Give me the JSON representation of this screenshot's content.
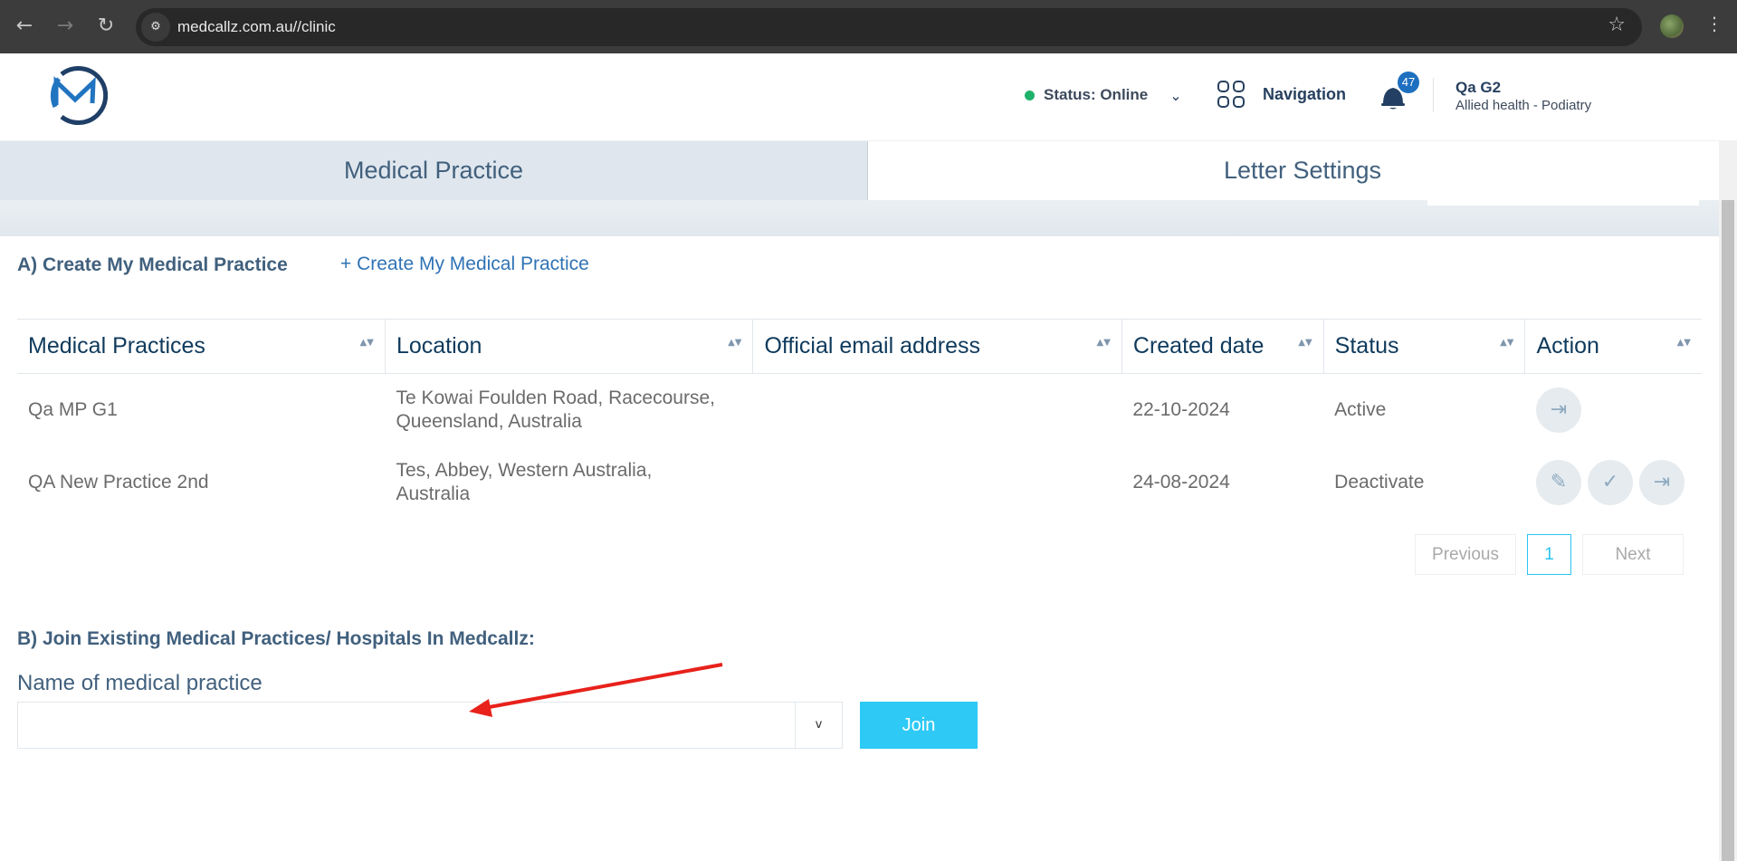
{
  "browser": {
    "url": "medcallz.com.au//clinic",
    "back_icon": "←",
    "forward_icon": "→",
    "reload_icon": "↻",
    "site_info_icon": "⚙",
    "star_icon": "☆",
    "menu_icon": "⋮"
  },
  "header": {
    "status_label": "Status: Online",
    "status_color": "#1fb26b",
    "status_chevron": "⌄",
    "navigation_label": "Navigation",
    "notification_count": "47",
    "user_name": "Qa G2",
    "user_role": "Allied health - Podiatry"
  },
  "tabs": [
    {
      "label": "Medical Practice",
      "active": true
    },
    {
      "label": "Letter Settings",
      "active": false
    }
  ],
  "section_a": {
    "title": "A) Create My Medical Practice",
    "create_link": "+ Create My Medical Practice"
  },
  "table": {
    "columns": [
      "Medical Practices",
      "Location",
      "Official email address",
      "Created date",
      "Status",
      "Action"
    ],
    "sort_icon": "▲▼",
    "rows": [
      {
        "practice": "Qa MP G1",
        "location": "Te Kowai Foulden Road, Racecourse, Queensland, Australia",
        "email": "",
        "created": "22-10-2024",
        "status": "Active",
        "actions": [
          "leave"
        ]
      },
      {
        "practice": "QA New Practice 2nd",
        "location": "Tes, Abbey, Western Australia, Australia",
        "email": "",
        "created": "24-08-2024",
        "status": "Deactivate",
        "actions": [
          "edit",
          "activate",
          "leave"
        ]
      }
    ]
  },
  "pagination": {
    "previous": "Previous",
    "current": "1",
    "next": "Next"
  },
  "section_b": {
    "title": "B) Join Existing Medical Practices/ Hospitals In Medcallz:",
    "field_label": "Name of medical practice",
    "select_value": "",
    "select_chevron": "v",
    "join_label": "Join",
    "join_color": "#2ec9f5"
  },
  "annotation": {
    "arrow_color": "#e8211b"
  }
}
